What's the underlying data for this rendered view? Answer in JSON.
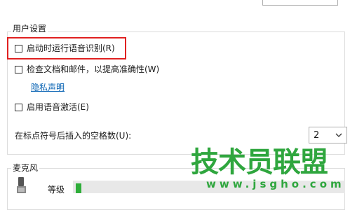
{
  "user_settings": {
    "group_label": "用户设置",
    "run_at_startup_label": "启动时运行语音识别(R)",
    "review_documents_label": "检查文档和邮件，以提高准确性(W)",
    "privacy_link": "隐私声明",
    "voice_activation_label": "启用语音激活(E)",
    "spaces_label": "在标点符号后插入的空格数(U):",
    "spaces_value": "2"
  },
  "microphone": {
    "group_label": "麦克风",
    "level_label": "等级",
    "level_fraction": 0.02
  },
  "watermark": {
    "main_text": "技术员联盟",
    "url_text": "www.jsgho.com"
  }
}
